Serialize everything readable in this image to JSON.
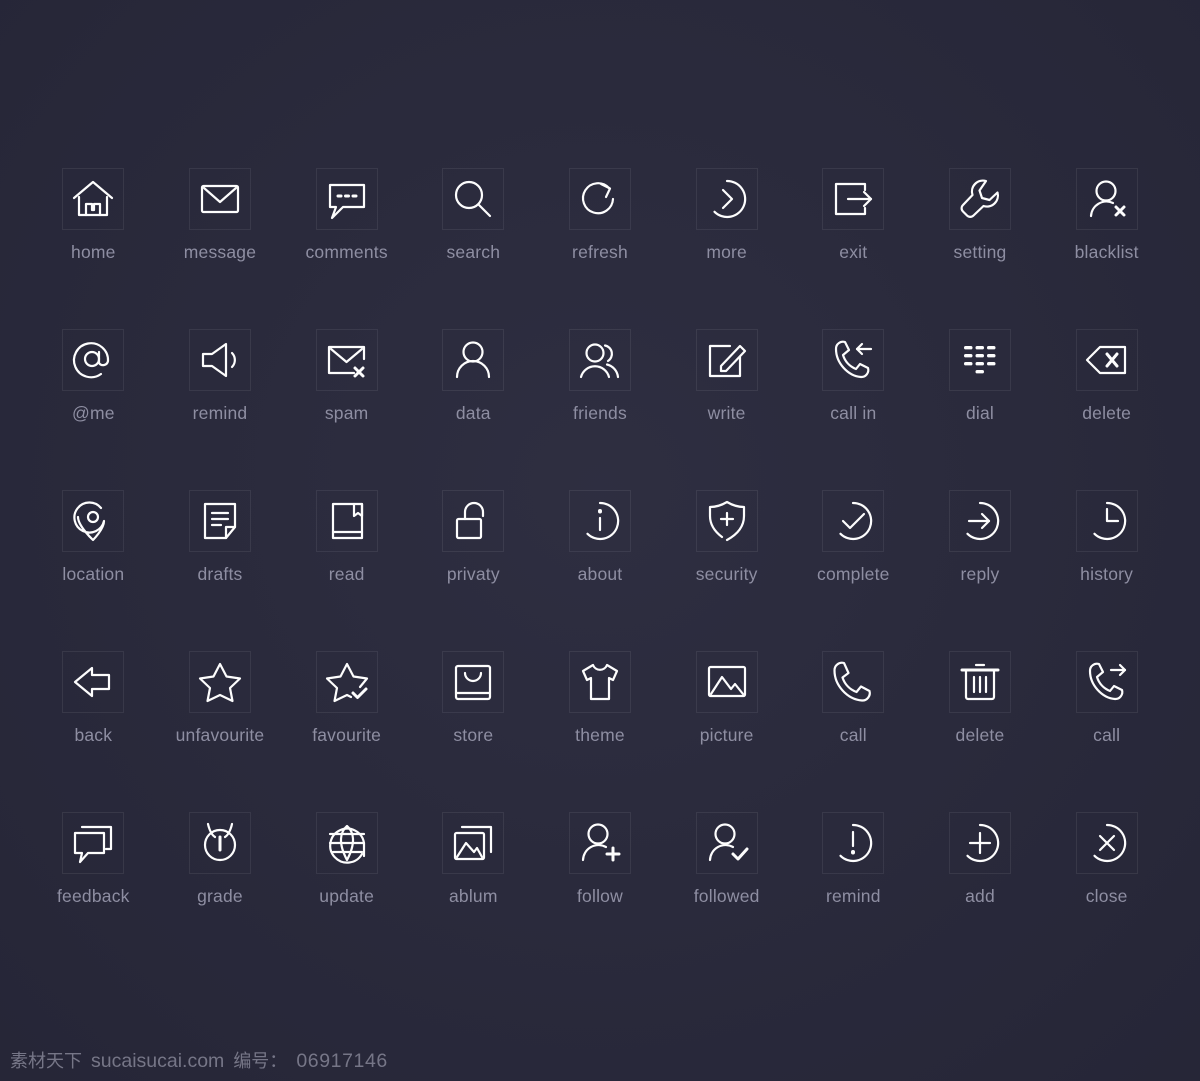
{
  "theme": {
    "background": "#2a2a3d",
    "icon_stroke": "#fdfdfd",
    "label_color": "#8e8ea2",
    "box_border": "rgba(255,255,255,0.075)",
    "footer_color": "#767687"
  },
  "grid": {
    "columns": 9,
    "rows": 5,
    "total_icons": 45
  },
  "icons": [
    {
      "label": "home",
      "icon": "home-icon"
    },
    {
      "label": "message",
      "icon": "envelope-icon"
    },
    {
      "label": "comments",
      "icon": "comment-bubble-icon"
    },
    {
      "label": "search",
      "icon": "magnifier-icon"
    },
    {
      "label": "refresh",
      "icon": "refresh-arrow-icon"
    },
    {
      "label": "more",
      "icon": "chevron-right-circle-icon"
    },
    {
      "label": "exit",
      "icon": "exit-arrow-icon"
    },
    {
      "label": "setting",
      "icon": "wrench-icon"
    },
    {
      "label": "blacklist",
      "icon": "user-x-icon"
    },
    {
      "label": "@me",
      "icon": "at-sign-icon"
    },
    {
      "label": "remind",
      "icon": "speaker-icon"
    },
    {
      "label": "spam",
      "icon": "envelope-x-icon"
    },
    {
      "label": "data",
      "icon": "user-icon"
    },
    {
      "label": "friends",
      "icon": "users-icon"
    },
    {
      "label": "write",
      "icon": "pencil-square-icon"
    },
    {
      "label": "call in",
      "icon": "phone-incoming-icon"
    },
    {
      "label": "dial",
      "icon": "dial-pad-icon"
    },
    {
      "label": "delete",
      "icon": "backspace-icon"
    },
    {
      "label": "location",
      "icon": "map-pin-icon"
    },
    {
      "label": "drafts",
      "icon": "draft-document-icon"
    },
    {
      "label": "read",
      "icon": "book-icon"
    },
    {
      "label": "privaty",
      "icon": "unlock-icon"
    },
    {
      "label": "about",
      "icon": "info-circle-icon"
    },
    {
      "label": "security",
      "icon": "shield-plus-icon"
    },
    {
      "label": "complete",
      "icon": "check-circle-icon"
    },
    {
      "label": "reply",
      "icon": "arrow-right-circle-icon"
    },
    {
      "label": "history",
      "icon": "clock-icon"
    },
    {
      "label": "back",
      "icon": "arrow-left-icon"
    },
    {
      "label": "unfavourite",
      "icon": "star-outline-icon"
    },
    {
      "label": "favourite",
      "icon": "star-check-icon"
    },
    {
      "label": "store",
      "icon": "shopping-bag-icon"
    },
    {
      "label": "theme",
      "icon": "tshirt-icon"
    },
    {
      "label": "picture",
      "icon": "image-icon"
    },
    {
      "label": "call",
      "icon": "phone-icon"
    },
    {
      "label": "delete",
      "icon": "trash-icon"
    },
    {
      "label": "call",
      "icon": "phone-outgoing-icon"
    },
    {
      "label": "feedback",
      "icon": "chat-stack-icon"
    },
    {
      "label": "grade",
      "icon": "alarm-clock-icon"
    },
    {
      "label": "update",
      "icon": "globe-icon"
    },
    {
      "label": "ablum",
      "icon": "photo-stack-icon"
    },
    {
      "label": "follow",
      "icon": "user-plus-icon"
    },
    {
      "label": "followed",
      "icon": "user-check-icon"
    },
    {
      "label": "remind",
      "icon": "exclamation-circle-icon"
    },
    {
      "label": "add",
      "icon": "plus-circle-icon"
    },
    {
      "label": "close",
      "icon": "x-circle-icon"
    }
  ],
  "footer": {
    "brand_cn": "素材天下",
    "site": "sucaisucai.com",
    "id_label_cn": "编号：",
    "id_value": "06917146"
  }
}
